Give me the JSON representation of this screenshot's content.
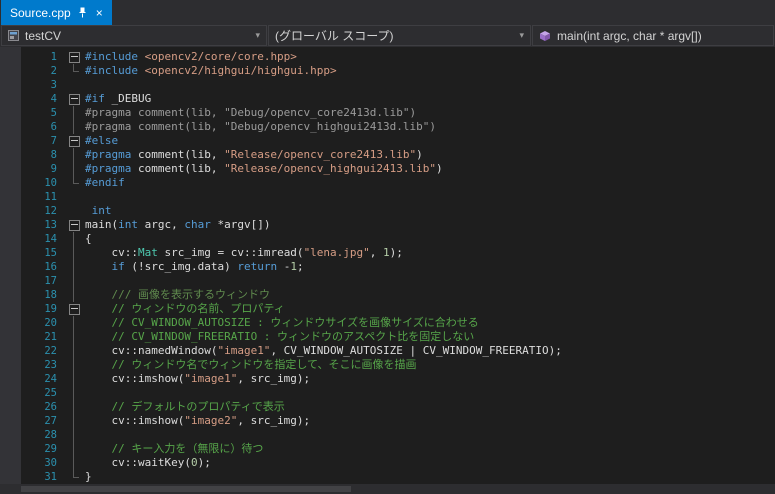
{
  "tab": {
    "title": "Source.cpp",
    "close_glyph": "×",
    "pin_icon": "pin-icon"
  },
  "navbar": {
    "project": {
      "label": "testCV",
      "icon": "cpp-project-icon"
    },
    "scope": {
      "label": "(グローバル スコープ)"
    },
    "member": {
      "label": "main(int argc, char * argv[])",
      "icon": "method-icon"
    },
    "dropdown_glyph": "▾"
  },
  "colors": {
    "accent": "#007acc",
    "editor_bg": "#1e1e1e",
    "chrome_bg": "#2d2d30",
    "line_number": "#2b91af",
    "keyword": "#569cd6",
    "string": "#d69d85",
    "comment": "#57a64a",
    "doc_comment": "#608b4e",
    "inactive_code": "#9b9b9b",
    "type": "#4ec9b0",
    "number": "#b5cea8",
    "text": "#dcdcdc"
  },
  "editor": {
    "lines": [
      {
        "n": 1,
        "fold": "box",
        "t": [
          [
            "pp",
            "#include"
          ],
          [
            "pl",
            " "
          ],
          [
            "str",
            "<opencv2/core/core.hpp>"
          ]
        ]
      },
      {
        "n": 2,
        "fold": "end",
        "t": [
          [
            "pp",
            "#include"
          ],
          [
            "pl",
            " "
          ],
          [
            "str",
            "<opencv2/highgui/highgui.hpp>"
          ]
        ]
      },
      {
        "n": 3,
        "fold": "",
        "t": []
      },
      {
        "n": 4,
        "fold": "box",
        "t": [
          [
            "pp",
            "#if"
          ],
          [
            "pl",
            " _DEBUG"
          ]
        ]
      },
      {
        "n": 5,
        "fold": "line",
        "t": [
          [
            "ina",
            "#pragma comment(lib, \"Debug/opencv_core2413d.lib\")"
          ]
        ]
      },
      {
        "n": 6,
        "fold": "line",
        "t": [
          [
            "ina",
            "#pragma comment(lib, \"Debug/opencv_highgui2413d.lib\")"
          ]
        ]
      },
      {
        "n": 7,
        "fold": "box",
        "t": [
          [
            "pp",
            "#else"
          ]
        ]
      },
      {
        "n": 8,
        "fold": "line",
        "t": [
          [
            "pp",
            "#pragma"
          ],
          [
            "pl",
            " comment(lib, "
          ],
          [
            "str",
            "\"Release/opencv_core2413.lib\""
          ],
          [
            "pl",
            ")"
          ]
        ]
      },
      {
        "n": 9,
        "fold": "line",
        "t": [
          [
            "pp",
            "#pragma"
          ],
          [
            "pl",
            " comment(lib, "
          ],
          [
            "str",
            "\"Release/opencv_highgui2413.lib\""
          ],
          [
            "pl",
            ")"
          ]
        ]
      },
      {
        "n": 10,
        "fold": "end",
        "t": [
          [
            "pp",
            "#endif"
          ]
        ]
      },
      {
        "n": 11,
        "fold": "",
        "t": []
      },
      {
        "n": 12,
        "fold": "",
        "t": [
          [
            "pl",
            " "
          ],
          [
            "kw",
            "int"
          ]
        ]
      },
      {
        "n": 13,
        "fold": "box",
        "t": [
          [
            "pl",
            "main("
          ],
          [
            "kw",
            "int"
          ],
          [
            "pl",
            " argc, "
          ],
          [
            "kw",
            "char"
          ],
          [
            "pl",
            " *argv[])"
          ]
        ]
      },
      {
        "n": 14,
        "fold": "line",
        "t": [
          [
            "pl",
            "{"
          ]
        ]
      },
      {
        "n": 15,
        "fold": "line",
        "t": [
          [
            "pl",
            "    cv::"
          ],
          [
            "ty",
            "Mat"
          ],
          [
            "pl",
            " src_img = cv::imread("
          ],
          [
            "str",
            "\"lena.jpg\""
          ],
          [
            "pl",
            ", "
          ],
          [
            "num",
            "1"
          ],
          [
            "pl",
            ");"
          ]
        ]
      },
      {
        "n": 16,
        "fold": "line",
        "t": [
          [
            "pl",
            "    "
          ],
          [
            "kw",
            "if"
          ],
          [
            "pl",
            " (!src_img.data) "
          ],
          [
            "kw",
            "return"
          ],
          [
            "pl",
            " -"
          ],
          [
            "num",
            "1"
          ],
          [
            "pl",
            ";"
          ]
        ]
      },
      {
        "n": 17,
        "fold": "line",
        "t": []
      },
      {
        "n": 18,
        "fold": "line",
        "t": [
          [
            "doc",
            "    /// 画像を表示するウィンドウ"
          ]
        ]
      },
      {
        "n": 19,
        "fold": "box",
        "t": [
          [
            "com",
            "    // ウィンドウの名前、プロパティ"
          ]
        ]
      },
      {
        "n": 20,
        "fold": "line",
        "t": [
          [
            "com",
            "    // CV_WINDOW_AUTOSIZE : ウィンドウサイズを画像サイズに合わせる"
          ]
        ]
      },
      {
        "n": 21,
        "fold": "line",
        "t": [
          [
            "com",
            "    // CV_WINDOW_FREERATIO : ウィンドウのアスペクト比を固定しない"
          ]
        ]
      },
      {
        "n": 22,
        "fold": "line",
        "t": [
          [
            "pl",
            "    cv::namedWindow("
          ],
          [
            "str",
            "\"image1\""
          ],
          [
            "pl",
            ", CV_WINDOW_AUTOSIZE | CV_WINDOW_FREERATIO);"
          ]
        ]
      },
      {
        "n": 23,
        "fold": "line",
        "t": [
          [
            "com",
            "    // ウィンドウ名でウィンドウを指定して、そこに画像を描画"
          ]
        ]
      },
      {
        "n": 24,
        "fold": "line",
        "t": [
          [
            "pl",
            "    cv::imshow("
          ],
          [
            "str",
            "\"image1\""
          ],
          [
            "pl",
            ", src_img);"
          ]
        ]
      },
      {
        "n": 25,
        "fold": "line",
        "t": []
      },
      {
        "n": 26,
        "fold": "line",
        "t": [
          [
            "com",
            "    // デフォルトのプロパティで表示"
          ]
        ]
      },
      {
        "n": 27,
        "fold": "line",
        "t": [
          [
            "pl",
            "    cv::imshow("
          ],
          [
            "str",
            "\"image2\""
          ],
          [
            "pl",
            ", src_img);"
          ]
        ]
      },
      {
        "n": 28,
        "fold": "line",
        "t": []
      },
      {
        "n": 29,
        "fold": "line",
        "t": [
          [
            "com",
            "    // キー入力を（無限に）待つ"
          ]
        ]
      },
      {
        "n": 30,
        "fold": "line",
        "t": [
          [
            "pl",
            "    cv::waitKey("
          ],
          [
            "num",
            "0"
          ],
          [
            "pl",
            ");"
          ]
        ]
      },
      {
        "n": 31,
        "fold": "end",
        "t": [
          [
            "pl",
            "}"
          ]
        ]
      }
    ]
  }
}
